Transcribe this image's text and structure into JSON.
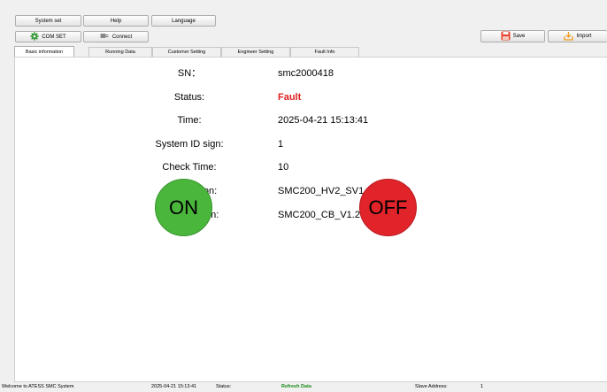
{
  "menu": {
    "system_set": "System set",
    "help": "Help",
    "language": "Language"
  },
  "toolbar": {
    "com_set": "COM SET",
    "connect": "Connect",
    "save": "Save",
    "import": "Import"
  },
  "tabs": [
    {
      "label": "Basic information",
      "active": true
    },
    {
      "label": "Running Data",
      "active": false
    },
    {
      "label": "Customer Setting",
      "active": false
    },
    {
      "label": "Engineer Setting",
      "active": false
    },
    {
      "label": "Fault Info",
      "active": false
    }
  ],
  "info": {
    "sn_label": "SN：",
    "sn_value": "smc2000418",
    "status_label": "Status:",
    "status_value": "Fault",
    "time_label": "Time:",
    "time_value": "2025-04-21 15:13:41",
    "sysid_label": "System ID sign:",
    "sysid_value": "1",
    "check_label": "Check Time:",
    "check_value": "10",
    "soft_label": "Soft Version:",
    "soft_value": "SMC200_HV2_SV1.1.40_APP",
    "hard_label": "Hard Version:",
    "hard_value": "SMC200_CB_V1.20"
  },
  "controls": {
    "on_label": "ON",
    "off_label": "OFF"
  },
  "statusbar": {
    "welcome": "Welcome to ATESS SMC System",
    "time": "2025-04-21 15:13:41",
    "status_label": "Status:",
    "status_value": "Refresh Data",
    "slave_label": "Slave Address:",
    "slave_value": "1"
  },
  "colors": {
    "fault": "#e02020",
    "on_button": "#4ab63c",
    "off_button": "#e1242a",
    "refresh_status": "#1a8a1a"
  }
}
